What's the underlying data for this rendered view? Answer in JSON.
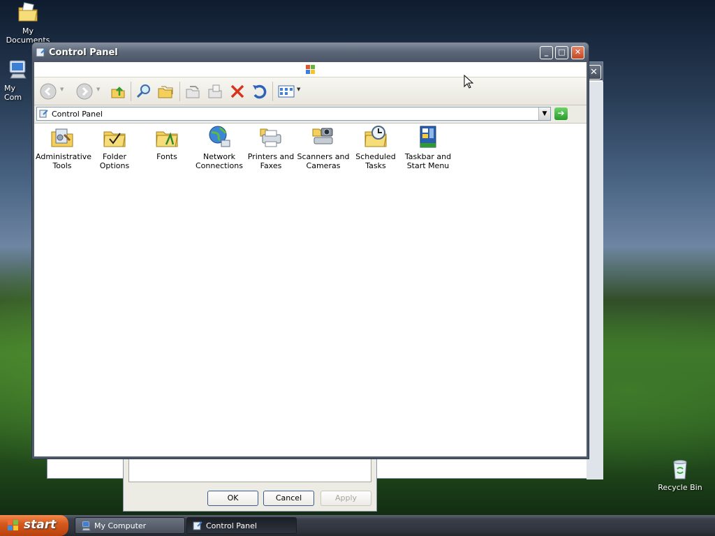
{
  "desktop": {
    "icons": [
      {
        "label": "My Documents"
      },
      {
        "label": "My Com"
      },
      {
        "label": "Recycle Bin"
      }
    ]
  },
  "dialog": {
    "ok_label": "OK",
    "cancel_label": "Cancel",
    "apply_label": "Apply"
  },
  "background_window": {
    "close_glyph": "✕"
  },
  "window": {
    "title": "Control Panel",
    "minimize_glyph": "_",
    "maximize_glyph": "□",
    "close_glyph": "✕"
  },
  "toolbar": {
    "icons": [
      "back-icon",
      "forward-icon",
      "up-folder-icon",
      "search-icon",
      "folders-icon",
      "move-to-icon",
      "copy-to-icon",
      "delete-icon",
      "undo-icon",
      "views-icon"
    ]
  },
  "address": {
    "value": "Control Panel",
    "dropdown_glyph": "▼",
    "go_glyph": "➔"
  },
  "items": [
    {
      "label": "Administrative Tools",
      "icon": "administrative-tools-icon"
    },
    {
      "label": "Folder Options",
      "icon": "folder-options-icon"
    },
    {
      "label": "Fonts",
      "icon": "fonts-icon"
    },
    {
      "label": "Network Connections",
      "icon": "network-connections-icon"
    },
    {
      "label": "Printers and Faxes",
      "icon": "printers-faxes-icon"
    },
    {
      "label": "Scanners and Cameras",
      "icon": "scanners-cameras-icon"
    },
    {
      "label": "Scheduled Tasks",
      "icon": "scheduled-tasks-icon"
    },
    {
      "label": "Taskbar and Start Menu",
      "icon": "taskbar-start-menu-icon"
    }
  ],
  "taskbar": {
    "start_label": "start",
    "tasks": [
      {
        "label": "My Computer",
        "active": false
      },
      {
        "label": "Control Panel",
        "active": true
      }
    ]
  },
  "colors": {
    "accent": "#4b5567",
    "start": "#d65a1d",
    "go": "#2a9a2a"
  }
}
